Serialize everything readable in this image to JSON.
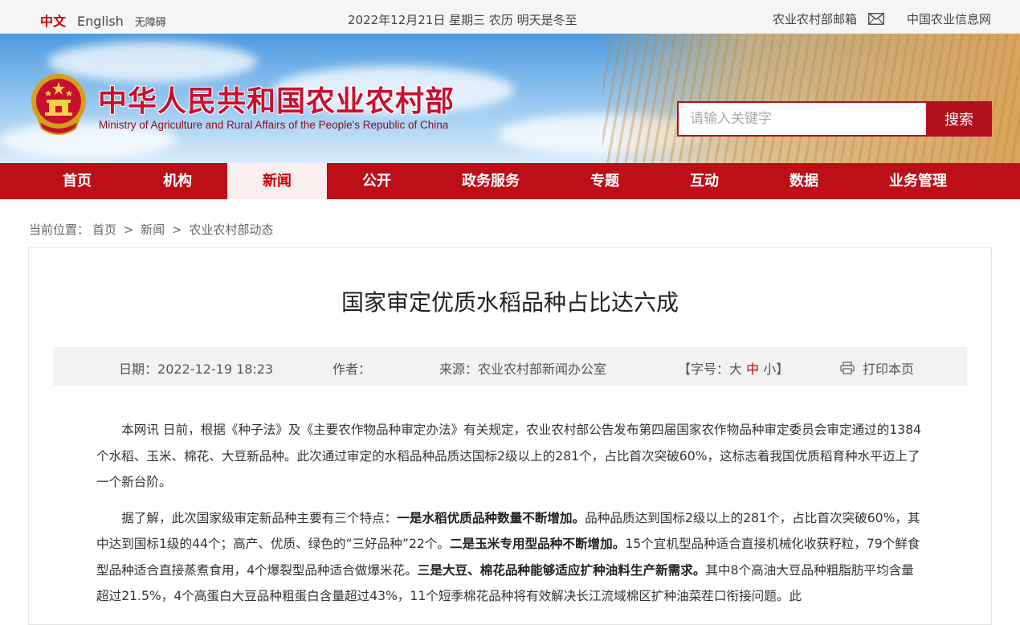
{
  "topbar": {
    "lang_zh": "中文",
    "lang_en": "English",
    "accessibility": "无障碍",
    "date": "2022年12月21日 星期三 农历 明天是冬至",
    "mailbox": "农业农村部邮箱",
    "info_net": "中国农业信息网"
  },
  "header": {
    "title_cn": "中华人民共和国农业农村部",
    "title_en": "Ministry of Agriculture and Rural Affairs of the People's Republic of China",
    "search_placeholder": "请输入关键字",
    "search_button": "搜索"
  },
  "nav": {
    "items": [
      {
        "label": "首页",
        "active": false
      },
      {
        "label": "机构",
        "active": false
      },
      {
        "label": "新闻",
        "active": true
      },
      {
        "label": "公开",
        "active": false
      },
      {
        "label": "政务服务",
        "active": false
      },
      {
        "label": "专题",
        "active": false
      },
      {
        "label": "互动",
        "active": false
      },
      {
        "label": "数据",
        "active": false
      },
      {
        "label": "业务管理",
        "active": false
      }
    ]
  },
  "breadcrumb": {
    "prefix": "当前位置：",
    "items": [
      "首页",
      "新闻",
      "农业农村部动态"
    ],
    "separator": ">"
  },
  "article": {
    "title": "国家审定优质水稻品种占比达六成",
    "date_label": "日期：",
    "date": "2022-12-19 18:23",
    "author_label": "作者：",
    "author": "",
    "source_label": "来源：",
    "source": "农业农村部新闻办公室",
    "font_size_open": "【字号：",
    "font_large": "大",
    "font_medium": "中",
    "font_small": "小",
    "font_size_close": "】",
    "print": "打印本页",
    "p1": "本网讯 日前，根据《种子法》及《主要农作物品种审定办法》有关规定，农业农村部公告发布第四届国家农作物品种审定委员会审定通过的1384个水稻、玉米、棉花、大豆新品种。此次通过审定的水稻品种品质达国标2级以上的281个，占比首次突破60%，这标志着我国优质稻育种水平迈上了一个新台阶。",
    "p2_a": "据了解，此次国家级审定新品种主要有三个特点：",
    "p2_b1": "一是水稻优质品种数量不断增加。",
    "p2_c": "品种品质达到国标2级以上的281个，占比首次突破60%，其中达到国标1级的44个；高产、优质、绿色的“三好品种”22个。",
    "p2_b2": "二是玉米专用型品种不断增加。",
    "p2_d": "15个宜机型品种适合直接机械化收获籽粒，79个鲜食型品种适合直接蒸煮食用，4个爆裂型品种适合做爆米花。",
    "p2_b3": "三是大豆、棉花品种能够适应扩种油料生产新需求。",
    "p2_e": "其中8个高油大豆品种粗脂肪平均含量超过21.5%，4个高蛋白大豆品种粗蛋白含量超过43%，11个短季棉花品种将有效解决长江流域棉区扩种油菜茬口衔接问题。此"
  }
}
